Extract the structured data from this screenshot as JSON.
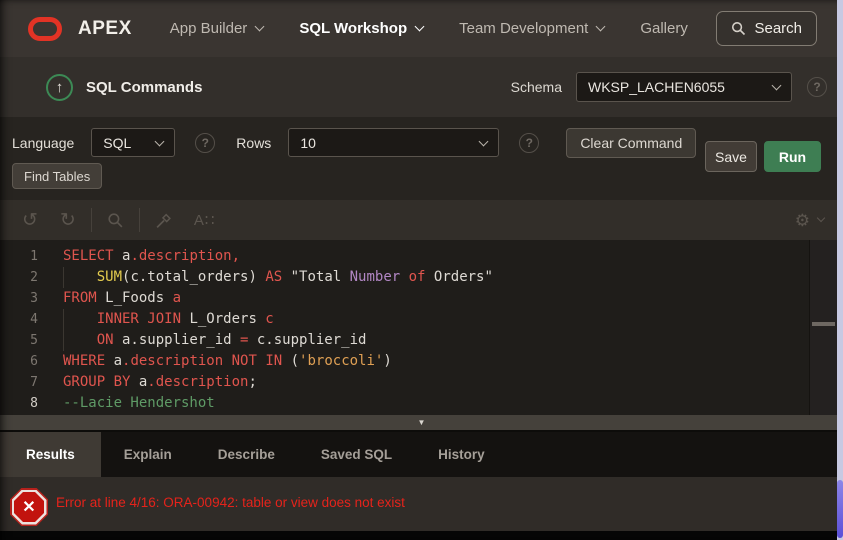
{
  "topnav": {
    "brand": "APEX",
    "items": [
      {
        "label": "App Builder",
        "chevron": true,
        "active": false
      },
      {
        "label": "SQL Workshop",
        "chevron": true,
        "active": true
      },
      {
        "label": "Team Development",
        "chevron": true,
        "active": false
      },
      {
        "label": "Gallery",
        "chevron": false,
        "active": false
      }
    ],
    "search_label": "Search"
  },
  "header": {
    "title": "SQL Commands",
    "schema_label": "Schema",
    "schema_value": "WKSP_LACHEN6055"
  },
  "controls": {
    "language_label": "Language",
    "language_value": "SQL",
    "rows_label": "Rows",
    "rows_value": "10",
    "clear_label": "Clear Command",
    "save_label": "Save",
    "run_label": "Run",
    "find_tables_label": "Find Tables",
    "help_glyph": "?"
  },
  "editor_toolbar_icons": {
    "undo": "↺",
    "redo": "↻",
    "autocomplete": "A∷",
    "gear": "⚙"
  },
  "up_arrow_glyph": "↑",
  "splitter_glyph": "▼",
  "editor": {
    "lines": [
      [
        {
          "t": "SELECT",
          "c": "kw"
        },
        {
          "t": " a",
          "c": "pln"
        },
        {
          "t": ".description,",
          "c": "kw"
        }
      ],
      [
        {
          "t": "    ",
          "c": "pln"
        },
        {
          "t": "SUM",
          "c": "fn"
        },
        {
          "t": "(c.total_orders) ",
          "c": "pln"
        },
        {
          "t": "AS",
          "c": "kw"
        },
        {
          "t": " \"Total ",
          "c": "pln"
        },
        {
          "t": "Number",
          "c": "kw2"
        },
        {
          "t": " ",
          "c": "pln"
        },
        {
          "t": "of",
          "c": "kw"
        },
        {
          "t": " Orders\"",
          "c": "pln"
        }
      ],
      [
        {
          "t": "FROM",
          "c": "kw"
        },
        {
          "t": " L_Foods",
          "c": "pln"
        },
        {
          "t": " a",
          "c": "kw"
        }
      ],
      [
        {
          "t": "    ",
          "c": "pln"
        },
        {
          "t": "INNER JOIN",
          "c": "kw"
        },
        {
          "t": " L_Orders",
          "c": "pln"
        },
        {
          "t": " c",
          "c": "kw"
        }
      ],
      [
        {
          "t": "    ",
          "c": "pln"
        },
        {
          "t": "ON",
          "c": "kw"
        },
        {
          "t": " a.supplier_id ",
          "c": "pln"
        },
        {
          "t": "=",
          "c": "kw"
        },
        {
          "t": " c.supplier_id",
          "c": "pln"
        }
      ],
      [
        {
          "t": "WHERE",
          "c": "kw"
        },
        {
          "t": " a",
          "c": "pln"
        },
        {
          "t": ".description",
          "c": "kw"
        },
        {
          "t": " ",
          "c": "pln"
        },
        {
          "t": "NOT IN",
          "c": "kw"
        },
        {
          "t": " (",
          "c": "pln"
        },
        {
          "t": "'broccoli'",
          "c": "str"
        },
        {
          "t": ")",
          "c": "pln"
        }
      ],
      [
        {
          "t": "GROUP BY",
          "c": "kw"
        },
        {
          "t": " a",
          "c": "pln"
        },
        {
          "t": ".description",
          "c": "kw"
        },
        {
          "t": ";",
          "c": "pln"
        }
      ],
      [
        {
          "t": "--Lacie Hendershot",
          "c": "com"
        }
      ]
    ]
  },
  "tabs": {
    "active": "Results",
    "items": [
      "Results",
      "Explain",
      "Describe",
      "Saved SQL",
      "History"
    ]
  },
  "results": {
    "error_message": "Error at line 4/16: ORA-00942: table or view does not exist",
    "error_icon_glyph": "✕"
  },
  "colors": {
    "accent_red": "#e23325",
    "run_green": "#3e7e53",
    "error_red": "#e5231b",
    "syntax_keyword": "#e0554e",
    "syntax_function": "#e3cb4e",
    "syntax_string": "#dfa054",
    "syntax_keyword2": "#b287c5",
    "syntax_comment": "#5f9b66"
  }
}
